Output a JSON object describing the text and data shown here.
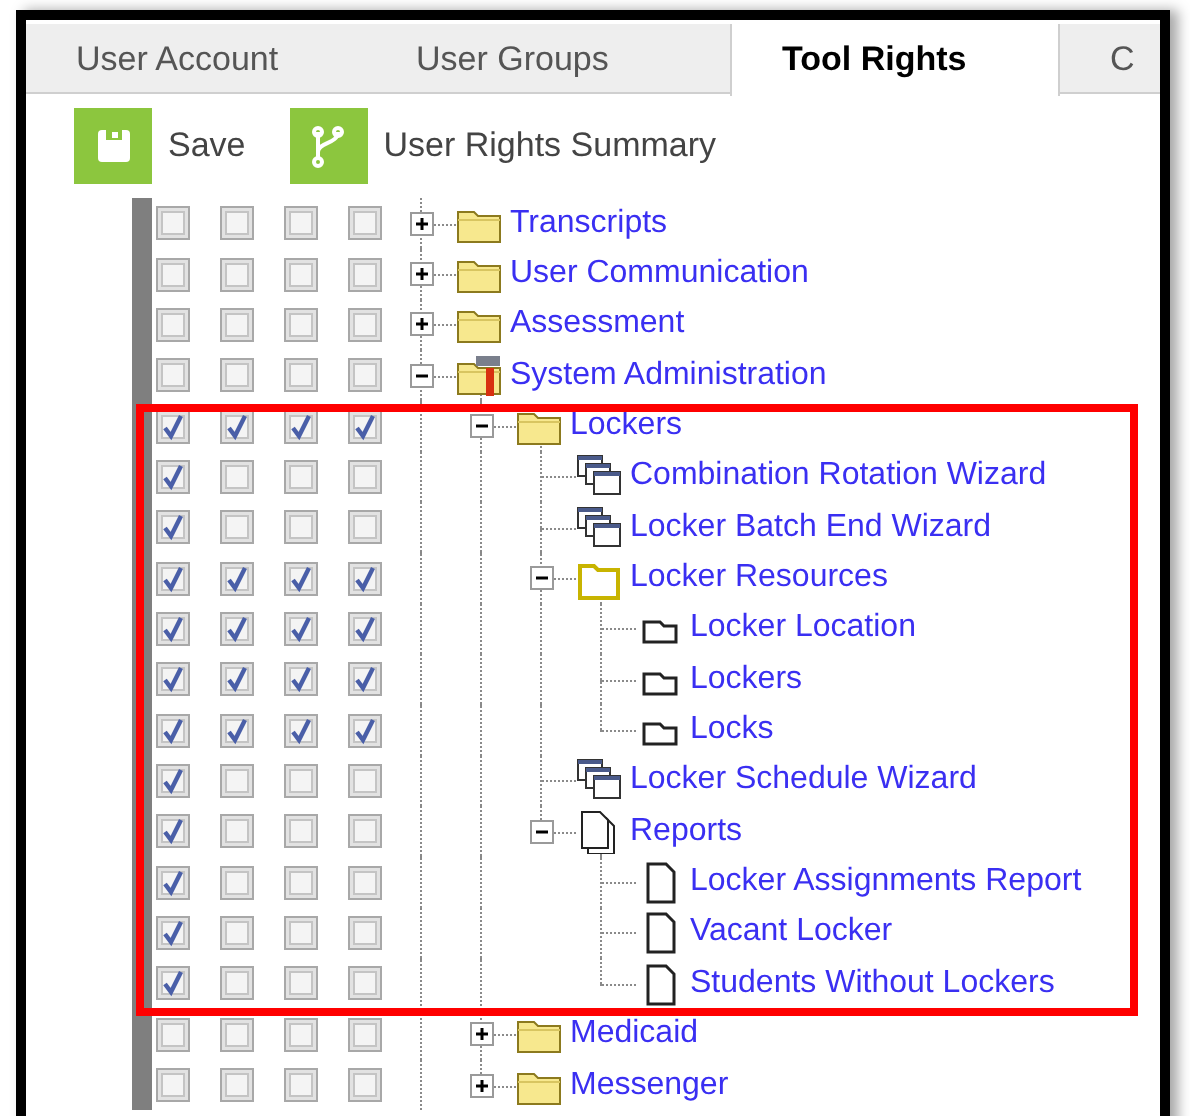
{
  "tabs": [
    {
      "label": "User Account",
      "selected": false
    },
    {
      "label": "User Groups",
      "selected": false
    },
    {
      "label": "Tool Rights",
      "selected": true
    },
    {
      "label": "C",
      "selected": false
    }
  ],
  "toolbar": [
    {
      "kind": "save",
      "label": "Save"
    },
    {
      "kind": "summary",
      "label": "User Rights Summary"
    }
  ],
  "tree": [
    {
      "label": "Transcripts",
      "kind": "folder",
      "expanded": false,
      "rights": [
        false,
        false,
        false,
        false
      ]
    },
    {
      "label": "User Communication",
      "kind": "folder",
      "expanded": false,
      "rights": [
        false,
        false,
        false,
        false
      ]
    },
    {
      "label": "Assessment",
      "kind": "folder",
      "expanded": false,
      "rights": [
        false,
        false,
        false,
        false
      ]
    },
    {
      "label": "System Administration",
      "kind": "system",
      "expanded": true,
      "rights": [
        false,
        false,
        false,
        false
      ],
      "children": [
        {
          "label": "Lockers",
          "kind": "folder",
          "expanded": true,
          "highlighted": true,
          "rights": [
            true,
            true,
            true,
            true
          ],
          "children": [
            {
              "label": "Combination Rotation Wizard",
              "kind": "wizard",
              "rights": [
                true,
                false,
                false,
                false
              ]
            },
            {
              "label": "Locker Batch End Wizard",
              "kind": "wizard",
              "rights": [
                true,
                false,
                false,
                false
              ]
            },
            {
              "label": "Locker Resources",
              "kind": "openfolder",
              "expanded": true,
              "rights": [
                true,
                true,
                true,
                true
              ],
              "children": [
                {
                  "label": "Locker Location",
                  "kind": "resource",
                  "rights": [
                    true,
                    true,
                    true,
                    true
                  ]
                },
                {
                  "label": "Lockers",
                  "kind": "resource",
                  "rights": [
                    true,
                    true,
                    true,
                    true
                  ]
                },
                {
                  "label": "Locks",
                  "kind": "resource",
                  "rights": [
                    true,
                    true,
                    true,
                    true
                  ]
                }
              ]
            },
            {
              "label": "Locker Schedule Wizard",
              "kind": "wizard",
              "rights": [
                true,
                false,
                false,
                false
              ]
            },
            {
              "label": "Reports",
              "kind": "reports",
              "expanded": true,
              "rights": [
                true,
                false,
                false,
                false
              ],
              "children": [
                {
                  "label": "Locker Assignments Report",
                  "kind": "report",
                  "rights": [
                    true,
                    false,
                    false,
                    false
                  ]
                },
                {
                  "label": "Vacant Locker",
                  "kind": "report",
                  "rights": [
                    true,
                    false,
                    false,
                    false
                  ]
                },
                {
                  "label": "Students Without Lockers",
                  "kind": "report",
                  "rights": [
                    true,
                    false,
                    false,
                    false
                  ]
                }
              ]
            }
          ]
        },
        {
          "label": "Medicaid",
          "kind": "folder",
          "expanded": false,
          "rights": [
            false,
            false,
            false,
            false
          ]
        },
        {
          "label": "Messenger",
          "kind": "folder",
          "expanded": false,
          "rights": [
            false,
            false,
            false,
            false
          ]
        }
      ]
    }
  ]
}
